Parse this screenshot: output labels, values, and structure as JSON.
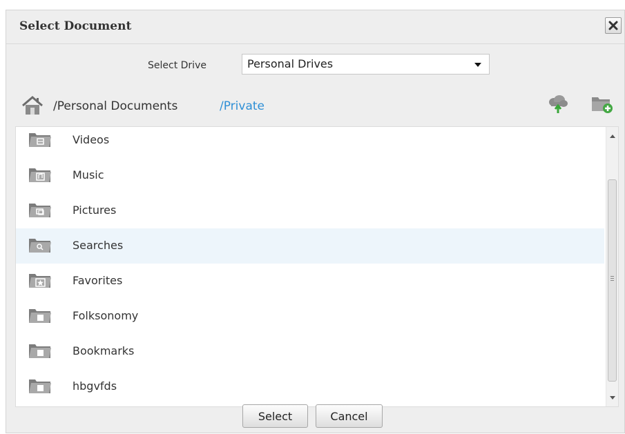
{
  "dialog": {
    "title": "Select Document",
    "close_icon": "close-icon"
  },
  "drive": {
    "label": "Select Drive",
    "selected": "Personal Drives"
  },
  "path": {
    "root": "/Personal Documents",
    "current": "/Private"
  },
  "toolbar": {
    "upload_icon": "upload-cloud-icon",
    "new_folder_icon": "new-folder-icon"
  },
  "folders": [
    {
      "label": "Videos",
      "icon": "videos-folder-icon"
    },
    {
      "label": "Music",
      "icon": "music-folder-icon"
    },
    {
      "label": "Pictures",
      "icon": "pictures-folder-icon"
    },
    {
      "label": "Searches",
      "icon": "searches-folder-icon",
      "highlighted": true
    },
    {
      "label": "Favorites",
      "icon": "favorites-folder-icon"
    },
    {
      "label": "Folksonomy",
      "icon": "folder-icon"
    },
    {
      "label": "Bookmarks",
      "icon": "folder-icon"
    },
    {
      "label": "hbgvfds",
      "icon": "folder-icon"
    }
  ],
  "buttons": {
    "select": "Select",
    "cancel": "Cancel"
  },
  "colors": {
    "link": "#2e8fd6",
    "highlight_row": "#edf5fb",
    "dialog_bg": "#eeeeee"
  }
}
